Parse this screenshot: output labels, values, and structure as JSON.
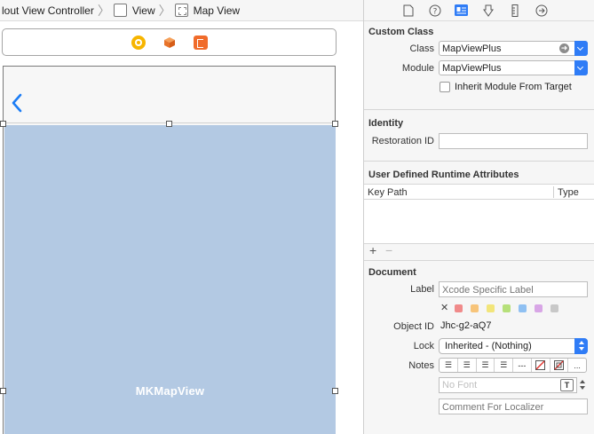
{
  "breadcrumb": {
    "items": [
      {
        "label": "lout View Controller",
        "icon": "none"
      },
      {
        "label": "View",
        "icon": "view-icon"
      },
      {
        "label": "Map View",
        "icon": "map-view-icon"
      }
    ]
  },
  "canvas": {
    "scene_dock_icons": [
      "view-controller-icon",
      "first-responder-icon",
      "exit-icon"
    ],
    "back_icon": "chevron-left-icon",
    "map_view_label": "MKMapView",
    "colors": {
      "map_fill": "#b3c9e3",
      "accent": "#2f7cf6",
      "chevron": "#1b7cf5"
    }
  },
  "inspector": {
    "tabs": [
      "file-inspector-icon",
      "quick-help-icon",
      "identity-inspector-icon",
      "attributes-inspector-icon",
      "size-inspector-icon",
      "connections-inspector-icon"
    ],
    "active_tab": "identity-inspector-icon",
    "custom_class": {
      "title": "Custom Class",
      "class_label": "Class",
      "class_value": "MapViewPlus",
      "module_label": "Module",
      "module_value": "MapViewPlus",
      "inherit_label": "Inherit Module From Target",
      "inherit_checked": false
    },
    "identity": {
      "title": "Identity",
      "restoration_label": "Restoration ID",
      "restoration_value": ""
    },
    "runtime_attributes": {
      "title": "User Defined Runtime Attributes",
      "col_keypath": "Key Path",
      "col_type": "Type",
      "add": "+",
      "remove": "−"
    },
    "document": {
      "title": "Document",
      "label_label": "Label",
      "label_placeholder": "Xcode Specific Label",
      "clear_color": "✕",
      "color_swatches": [
        "#f08a8a",
        "#f7c47a",
        "#f2e57a",
        "#b6e07a",
        "#8fc0f2",
        "#d8a6e6",
        "#c8c8c8"
      ],
      "object_id_label": "Object ID",
      "object_id_value": "Jhc-g2-aQ7",
      "lock_label": "Lock",
      "lock_value": "Inherited - (Nothing)",
      "notes_label": "Notes",
      "notes_more": "...",
      "font_placeholder": "No Font",
      "font_button": "T",
      "comment_placeholder": "Comment For Localizer"
    }
  }
}
